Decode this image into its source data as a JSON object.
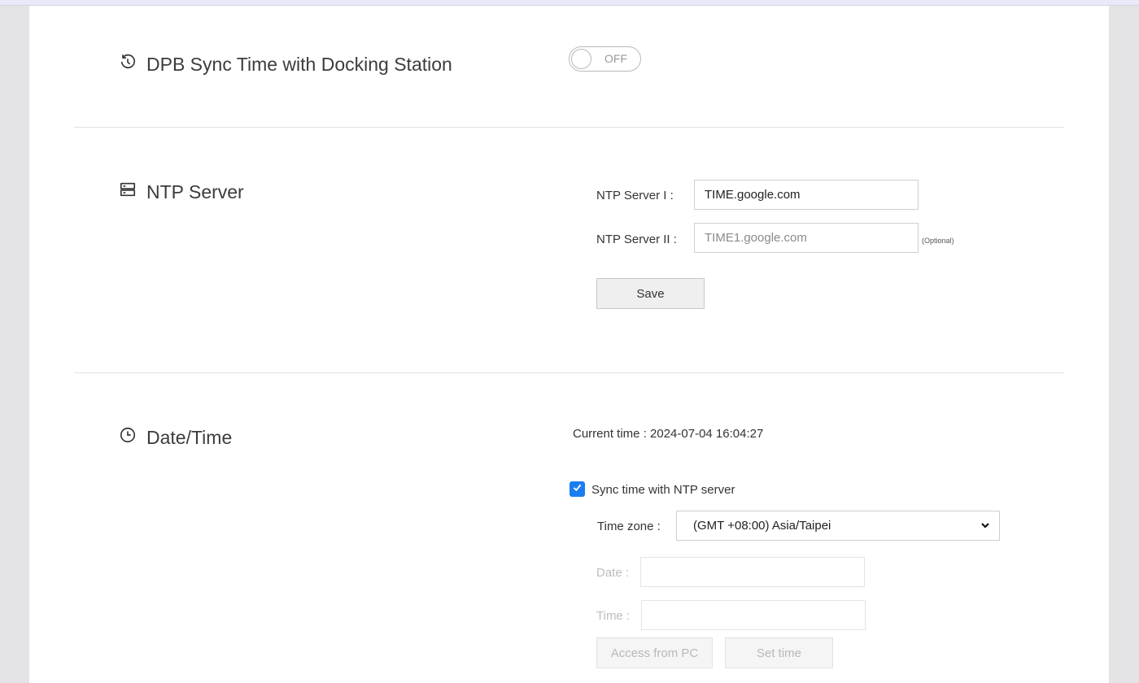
{
  "sync_section": {
    "title": "DPB Sync Time with Docking Station",
    "icon": "clock-sync-icon",
    "toggle_state": "OFF"
  },
  "ntp_section": {
    "title": "NTP Server",
    "icon": "server-icon",
    "server1_label": "NTP Server I :",
    "server1_value": "TIME.google.com",
    "server2_label": "NTP Server II :",
    "server2_placeholder": "TIME1.google.com",
    "optional_note": "(Optional)",
    "save_label": "Save"
  },
  "datetime_section": {
    "title": "Date/Time",
    "icon": "clock-icon",
    "current_time_label": "Current time : 2024-07-04 16:04:27",
    "sync_ntp_label": "Sync time with NTP server",
    "sync_ntp_checked": true,
    "timezone_label": "Time zone :",
    "timezone_value": "(GMT +08:00) Asia/Taipei",
    "date_label": "Date :",
    "date_value": "",
    "time_label": "Time :",
    "time_value": "",
    "access_pc_label": "Access from PC",
    "set_time_label": "Set time"
  },
  "colors": {
    "accent": "#1a7ef0",
    "background": "#e4e4e6",
    "panel": "#ffffff"
  }
}
